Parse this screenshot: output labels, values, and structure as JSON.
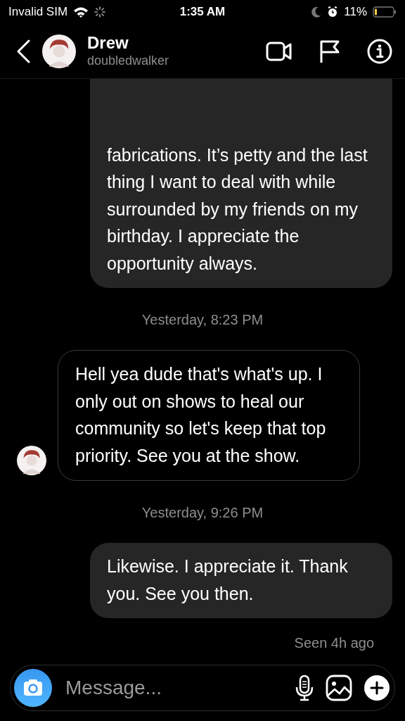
{
  "status_bar": {
    "carrier": "Invalid SIM",
    "time": "1:35 AM",
    "battery": "11%"
  },
  "header": {
    "name": "Drew",
    "username": "doubledwalker"
  },
  "messages": [
    {
      "kind": "sent",
      "text": "fabrications. It’s petty and the last thing I want to deal with while surrounded by my friends on my birthday. I appreciate the opportunity always."
    },
    {
      "kind": "time",
      "text": "Yesterday, 8:23 PM"
    },
    {
      "kind": "received",
      "text": "Hell yea dude that's what's up. I only out on shows to heal our community so let's keep that top priority. See you at the show."
    },
    {
      "kind": "time",
      "text": "Yesterday, 9:26 PM"
    },
    {
      "kind": "sent",
      "text": "Likewise. I appreciate it. Thank you. See you then."
    }
  ],
  "seen": "Seen 4h ago",
  "composer": {
    "placeholder": "Message..."
  }
}
